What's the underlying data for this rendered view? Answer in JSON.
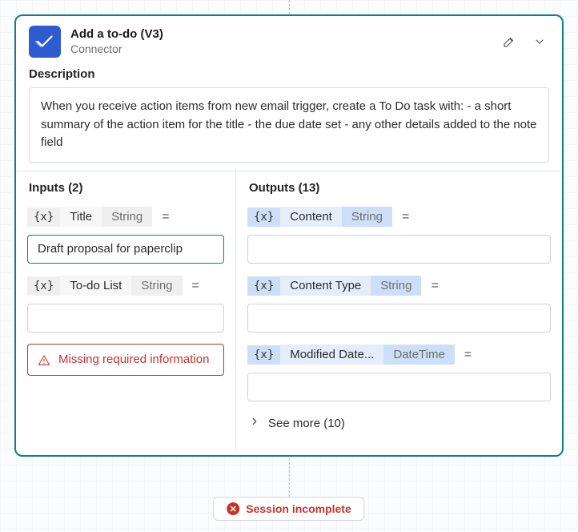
{
  "header": {
    "title": "Add a to-do (V3)",
    "subtitle": "Connector"
  },
  "description": {
    "label": "Description",
    "text": "When you receive action items from new email trigger, create a To Do task with: - a short summary of the action item for the title - the due date set - any other details added to the note field"
  },
  "inputs": {
    "heading": "Inputs (2)",
    "var_token": "{x}",
    "eq": "=",
    "params": {
      "title": {
        "name": "Title",
        "type": "String",
        "value": "Draft proposal for paperclip"
      },
      "todo_list": {
        "name": "To-do List",
        "type": "String",
        "value": ""
      }
    },
    "error": "Missing required information"
  },
  "outputs": {
    "heading": "Outputs (13)",
    "var_token": "{x}",
    "eq": "=",
    "params": {
      "content": {
        "name": "Content",
        "type": "String",
        "value": ""
      },
      "content_type": {
        "name": "Content Type",
        "type": "String",
        "value": ""
      },
      "modified_date": {
        "name": "Modified Date...",
        "type": "DateTime",
        "value": ""
      }
    },
    "see_more": "See more (10)"
  },
  "status": "Session incomplete"
}
